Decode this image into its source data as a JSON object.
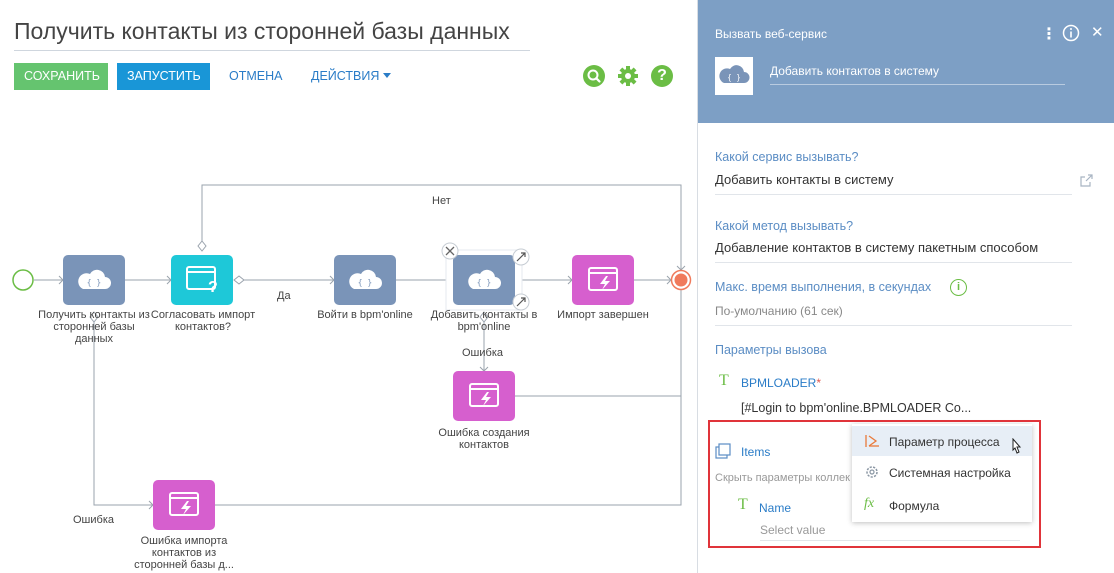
{
  "designer": {
    "title": "Получить контакты из сторонней базы данных",
    "toolbar": {
      "save_label": "СОХРАНИТЬ",
      "run_label": "ЗАПУСТИТЬ",
      "cancel_label": "ОТМЕНА",
      "actions_label": "ДЕЙСТВИЯ"
    },
    "nodes": {
      "get_contacts": "Получить контакты из сторонней базы данных",
      "approve_import": "Согласовать импорт контактов?",
      "login": "Войти в bpm'online",
      "add_contacts": "Добавить контакты в bpm'online",
      "import_done": "Импорт завершен",
      "error_create": "Ошибка создания контактов",
      "error_import": "Ошибка импорта контактов из сторонней базы д..."
    },
    "edges": {
      "no": "Нет",
      "yes": "Да",
      "error_1": "Ошибка",
      "error_2": "Ошибка"
    }
  },
  "panel": {
    "element_type": "Вызвать веб-сервис",
    "element_name": "Добавить контактов в систему",
    "service_label": "Какой сервис вызывать?",
    "service_value": "Добавить контакты в систему",
    "method_label": "Какой метод вызывать?",
    "method_value": "Добавление контактов в систему пакетным способом",
    "timeout_label": "Макс. время выполнения, в секундах",
    "timeout_value": "По-умолчанию (61 сек)",
    "params_label": "Параметры вызова",
    "param_bpmloader_name": "BPMLOADER",
    "param_required_mark": "*",
    "param_bpmloader_value": "[#Login to bpm'online.BPMLOADER Co...",
    "param_items_name": "Items",
    "items_hint": "Скрыть параметры коллек",
    "param_name_name": "Name",
    "name_placeholder": "Select value"
  },
  "dropdown": {
    "options": [
      "Параметр процесса",
      "Системная настройка",
      "Формула"
    ],
    "selected": "Параметр процесса"
  },
  "colors": {
    "save": "#65c46f",
    "run": "#1996d7",
    "panel_header": "#7d9fc5",
    "task_blue": "#7a94b8",
    "task_cyan": "#1ec8d8",
    "task_magenta": "#d65fce",
    "start": "#6bbd45",
    "end": "#f07a5c",
    "highlight": "#e0343a"
  }
}
